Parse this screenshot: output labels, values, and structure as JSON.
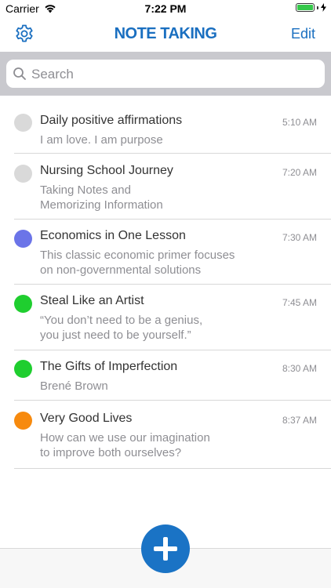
{
  "status_bar": {
    "carrier": "Carrier",
    "time": "7:22 PM"
  },
  "nav": {
    "title": "NOTE TAKING",
    "edit_label": "Edit",
    "settings_icon": "gear-icon"
  },
  "search": {
    "placeholder": "Search"
  },
  "colors": {
    "accent": "#1a6fc0",
    "add_button": "#1a73c5"
  },
  "notes": [
    {
      "title": "Daily positive affirmations",
      "time": "5:10 AM",
      "lines": [
        "I am love. I am purpose"
      ],
      "color": "#d9d9d9"
    },
    {
      "title": "Nursing School Journey",
      "time": "7:20 AM",
      "lines": [
        "Taking Notes and",
        "Memorizing Information"
      ],
      "color": "#d9d9d9"
    },
    {
      "title": "Economics in One Lesson",
      "time": "7:30 AM",
      "lines": [
        "This classic economic primer focuses",
        "on non-governmental solutions"
      ],
      "color": "#6b74e8"
    },
    {
      "title": "Steal Like an Artist",
      "time": "7:45 AM",
      "lines": [
        "“You don’t need to be a genius,",
        "you just need to be yourself.”"
      ],
      "color": "#1fce2f"
    },
    {
      "title": "The Gifts of Imperfection",
      "time": "8:30 AM",
      "lines": [
        "Brené Brown"
      ],
      "color": "#1fce2f"
    },
    {
      "title": "Very Good Lives",
      "time": "8:37 AM",
      "lines": [
        "How can we use our imagination",
        "to improve both ourselves?"
      ],
      "color": "#f78a0e"
    }
  ]
}
